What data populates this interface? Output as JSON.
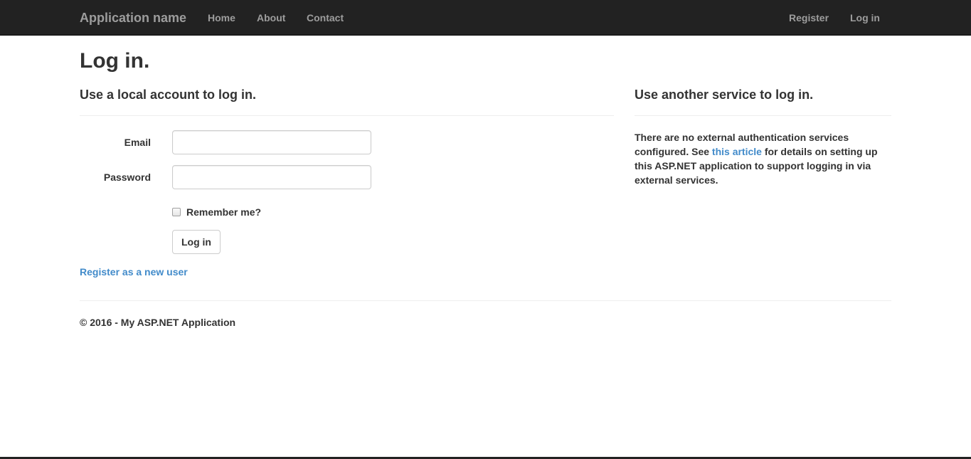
{
  "navbar": {
    "brand": "Application name",
    "links": [
      "Home",
      "About",
      "Contact"
    ],
    "right_links": [
      "Register",
      "Log in"
    ]
  },
  "page": {
    "title": "Log in."
  },
  "local": {
    "heading": "Use a local account to log in.",
    "email_label": "Email",
    "email_value": "",
    "password_label": "Password",
    "password_value": "",
    "remember_label": "Remember me?",
    "remember_checked": false,
    "login_button": "Log in",
    "register_link": "Register as a new user"
  },
  "external": {
    "heading": "Use another service to log in.",
    "text_before": "There are no external authentication services configured. See ",
    "link_text": "this article",
    "text_after": " for details on setting up this ASP.NET application to support logging in via external services."
  },
  "footer": {
    "text": "© 2016 - My ASP.NET Application"
  },
  "colors": {
    "navbar_bg": "#222222",
    "nav_text": "#9d9d9d",
    "link": "#428bca",
    "text": "#333333"
  }
}
